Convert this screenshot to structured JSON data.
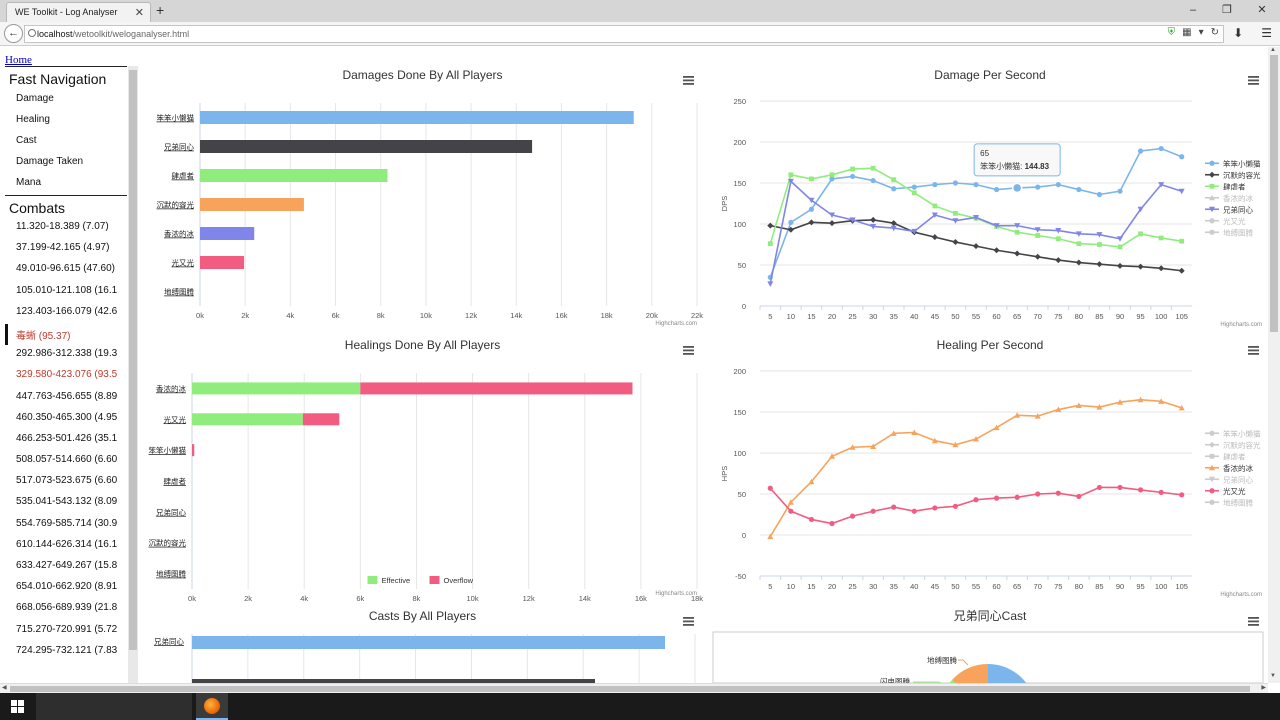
{
  "browser": {
    "tab_title": "WE Toolkit - Log Analyser",
    "url_host": "localhost",
    "url_path": "/wetoolkit/weloganalyser.html"
  },
  "page": {
    "home_link": "Home",
    "fast_nav_title": "Fast Navigation",
    "fast_nav": [
      "Damage",
      "Healing",
      "Cast",
      "Damage Taken",
      "Mana"
    ],
    "combats_title": "Combats",
    "combats": [
      {
        "label": "11.320-18.389 (7.07)",
        "style": "normal"
      },
      {
        "label": "37.199-42.165 (4.97)",
        "style": "normal"
      },
      {
        "label": "49.010-96.615 (47.60)",
        "style": "normal"
      },
      {
        "label": "105.010-121.108 (16.1",
        "style": "normal"
      },
      {
        "label": "123.403-166.079 (42.6",
        "style": "normal"
      },
      {
        "label": "毒蜥 (95.37)",
        "style": "active"
      },
      {
        "label": "292.986-312.338 (19.3",
        "style": "normal"
      },
      {
        "label": "329.580-423.076 (93.5",
        "style": "red"
      },
      {
        "label": "447.763-456.655 (8.89",
        "style": "normal"
      },
      {
        "label": "460.350-465.300 (4.95",
        "style": "normal"
      },
      {
        "label": "466.253-501.426 (35.1",
        "style": "normal"
      },
      {
        "label": "508.057-514.660 (6.60",
        "style": "normal"
      },
      {
        "label": "517.073-523.675 (6.60",
        "style": "normal"
      },
      {
        "label": "535.041-543.132 (8.09",
        "style": "normal"
      },
      {
        "label": "554.769-585.714 (30.9",
        "style": "normal"
      },
      {
        "label": "610.144-626.314 (16.1",
        "style": "normal"
      },
      {
        "label": "633.427-649.267 (15.8",
        "style": "normal"
      },
      {
        "label": "654.010-662.920 (8.91",
        "style": "normal"
      },
      {
        "label": "668.056-689.939 (21.8",
        "style": "normal"
      },
      {
        "label": "715.270-720.991 (5.72",
        "style": "normal"
      },
      {
        "label": "724.295-732.121 (7.83",
        "style": "normal"
      }
    ],
    "credits": "Highcharts.com"
  },
  "chart_data": [
    {
      "id": "damage_done",
      "type": "bar",
      "title": "Damages Done By All Players",
      "categories": [
        "笨笨小懒猫",
        "兄弟同心",
        "肆虐者",
        "沉默的容光",
        "香浓的冰",
        "光又光",
        "地缚图腾"
      ],
      "values": [
        19200,
        14700,
        8300,
        4600,
        2400,
        1950,
        0
      ],
      "colors": [
        "#7cb5ec",
        "#434348",
        "#90ed7d",
        "#f7a35c",
        "#8085e9",
        "#f15c80",
        "#e4d354"
      ],
      "xlim": [
        0,
        22000
      ],
      "ticks": [
        "0k",
        "2k",
        "4k",
        "6k",
        "8k",
        "10k",
        "12k",
        "14k",
        "16k",
        "18k",
        "20k",
        "22k"
      ]
    },
    {
      "id": "dps",
      "type": "line",
      "title": "Damage Per Second",
      "ylabel": "DPS",
      "x": [
        5,
        10,
        15,
        20,
        25,
        30,
        35,
        40,
        45,
        50,
        55,
        60,
        65,
        70,
        75,
        80,
        85,
        90,
        95,
        100,
        105
      ],
      "ylim": [
        0,
        250
      ],
      "yticks": [
        0,
        50,
        100,
        150,
        200,
        250
      ],
      "series": [
        {
          "name": "笨笨小懒猫",
          "color": "#7cb5ec",
          "marker": "circle",
          "visible": true,
          "values": [
            35,
            102,
            118,
            155,
            158,
            153,
            143,
            145,
            148,
            150,
            148,
            142,
            144,
            145,
            148,
            142,
            136,
            140,
            189,
            192,
            182
          ]
        },
        {
          "name": "沉默的容光",
          "color": "#434348",
          "marker": "diamond",
          "visible": true,
          "values": [
            98,
            93,
            102,
            101,
            104,
            105,
            101,
            90,
            84,
            78,
            73,
            68,
            64,
            60,
            56,
            53,
            51,
            49,
            48,
            46,
            43
          ]
        },
        {
          "name": "肆虐者",
          "color": "#90ed7d",
          "marker": "square",
          "visible": true,
          "values": [
            76,
            160,
            155,
            160,
            167,
            168,
            154,
            138,
            122,
            113,
            107,
            97,
            90,
            86,
            82,
            76,
            75,
            72,
            88,
            83,
            79
          ]
        },
        {
          "name": "香浓的冰",
          "color": "#f7a35c",
          "marker": "triangle",
          "visible": false,
          "values": []
        },
        {
          "name": "兄弟同心",
          "color": "#8085e9",
          "marker": "triangle-down",
          "visible": true,
          "values": [
            27,
            152,
            129,
            111,
            105,
            97,
            95,
            91,
            111,
            104,
            108,
            98,
            98,
            93,
            92,
            88,
            87,
            82,
            118,
            148,
            140
          ]
        },
        {
          "name": "光又光",
          "color": "#f15c80",
          "marker": "circle",
          "visible": false,
          "values": []
        },
        {
          "name": "地缚图腾",
          "color": "#e4d354",
          "marker": "circle",
          "visible": false,
          "values": []
        }
      ],
      "tooltip": {
        "x": "65",
        "series": "笨笨小懒猫",
        "value": "144.83"
      }
    },
    {
      "id": "healing_done",
      "type": "stacked-bar",
      "title": "Healings Done By All Players",
      "categories": [
        "香浓的冰",
        "光又光",
        "笨笨小懒猫",
        "肆虐者",
        "兄弟同心",
        "沉默的容光",
        "地缚图腾"
      ],
      "series": [
        {
          "name": "Effective",
          "color": "#90ed7d",
          "values": [
            6000,
            3950,
            0,
            0,
            0,
            0,
            0
          ]
        },
        {
          "name": "Overflow",
          "color": "#f15c80",
          "values": [
            9700,
            1300,
            80,
            0,
            0,
            0,
            0
          ]
        }
      ],
      "xlim": [
        0,
        18000
      ],
      "ticks": [
        "0k",
        "2k",
        "4k",
        "6k",
        "8k",
        "10k",
        "12k",
        "14k",
        "16k",
        "18k"
      ],
      "legend": "bottom-center"
    },
    {
      "id": "hps",
      "type": "line",
      "title": "Healing Per Second",
      "ylabel": "HPS",
      "x": [
        5,
        10,
        15,
        20,
        25,
        30,
        35,
        40,
        45,
        50,
        55,
        60,
        65,
        70,
        75,
        80,
        85,
        90,
        95,
        100,
        105
      ],
      "ylim": [
        -50,
        200
      ],
      "yticks": [
        -50,
        0,
        50,
        100,
        150,
        200
      ],
      "series": [
        {
          "name": "笨笨小懒猫",
          "color": "#7cb5ec",
          "marker": "circle",
          "visible": false,
          "values": []
        },
        {
          "name": "沉默的容光",
          "color": "#434348",
          "marker": "diamond",
          "visible": false,
          "values": []
        },
        {
          "name": "肆虐者",
          "color": "#90ed7d",
          "marker": "square",
          "visible": false,
          "values": []
        },
        {
          "name": "香浓的冰",
          "color": "#f7a35c",
          "marker": "triangle",
          "visible": true,
          "values": [
            -2,
            40,
            65,
            96,
            107,
            108,
            124,
            125,
            115,
            110,
            117,
            131,
            146,
            145,
            153,
            158,
            156,
            162,
            165,
            163,
            155
          ]
        },
        {
          "name": "兄弟同心",
          "color": "#8085e9",
          "marker": "triangle-down",
          "visible": false,
          "values": []
        },
        {
          "name": "光又光",
          "color": "#f15c80",
          "marker": "circle",
          "visible": true,
          "values": [
            57,
            29,
            19,
            14,
            23,
            29,
            34,
            29,
            33,
            35,
            43,
            45,
            46,
            50,
            51,
            47,
            58,
            58,
            55,
            52,
            49
          ]
        },
        {
          "name": "地缚图腾",
          "color": "#e4d354",
          "marker": "circle",
          "visible": false,
          "values": []
        }
      ]
    },
    {
      "id": "casts",
      "type": "bar",
      "title": "Casts By All Players",
      "categories": [
        "兄弟同心"
      ],
      "values": [
        100
      ],
      "colors": [
        "#7cb5ec"
      ]
    },
    {
      "id": "cast_pie",
      "type": "pie",
      "title": "兄弟同心Cast",
      "labels": [
        "地缚图腾",
        "闪电图腾"
      ]
    }
  ]
}
